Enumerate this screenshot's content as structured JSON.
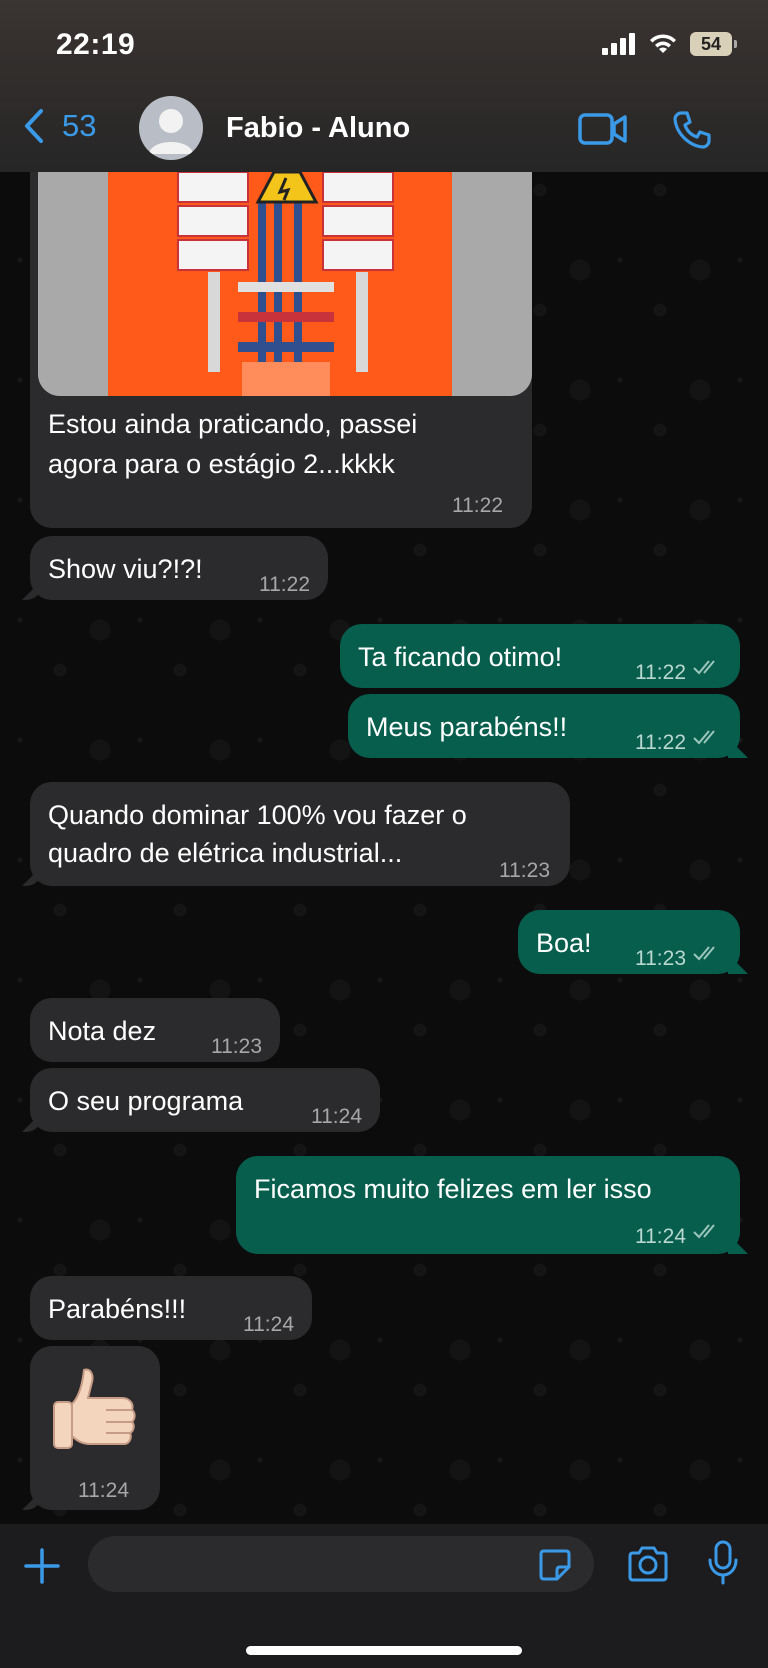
{
  "status_bar": {
    "time": "22:19",
    "battery": "54"
  },
  "header": {
    "back_count": "53",
    "contact_name": "Fabio - Aluno"
  },
  "messages": [
    {
      "direction": "in",
      "text_line1": "Estou ainda praticando,  passei",
      "text_line2": "agora para o estágio 2...kkkk",
      "time": "11:22",
      "has_image": true
    },
    {
      "direction": "in",
      "text": "Show viu?!?!",
      "time": "11:22"
    },
    {
      "direction": "out",
      "text": "Ta ficando otimo!",
      "time": "11:22"
    },
    {
      "direction": "out",
      "text": "Meus parabéns!!",
      "time": "11:22"
    },
    {
      "direction": "in",
      "text_line1": "Quando dominar 100% vou fazer o",
      "text_line2": "quadro de elétrica industrial...",
      "time": "11:23"
    },
    {
      "direction": "out",
      "text": "Boa!",
      "time": "11:23"
    },
    {
      "direction": "in",
      "text": "Nota dez",
      "time": "11:23"
    },
    {
      "direction": "in",
      "text": "O seu programa",
      "time": "11:24"
    },
    {
      "direction": "out",
      "text": "Ficamos muito felizes em ler isso",
      "time": "11:24"
    },
    {
      "direction": "in",
      "text": "Parabéns!!!",
      "time": "11:24"
    },
    {
      "direction": "in",
      "emoji": "👍🏻",
      "time": "11:24"
    }
  ],
  "colors": {
    "accent": "#3b9ae8",
    "incoming": "#2b2b2d",
    "outgoing": "#075e4d",
    "panel_orange": "#ff5a1a"
  }
}
